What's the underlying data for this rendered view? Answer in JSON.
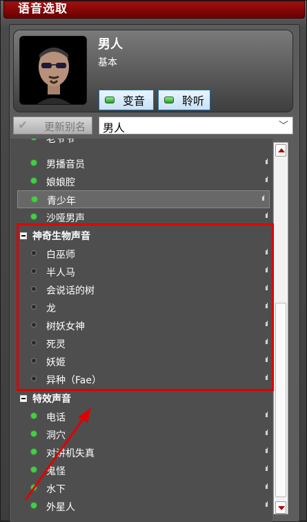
{
  "window": {
    "title": "语音选取"
  },
  "profile": {
    "name": "男人",
    "type": "基本"
  },
  "buttons": {
    "change_voice": "变音",
    "listen": "聆听"
  },
  "alias": {
    "button_label": "更新别名",
    "selected": "男人"
  },
  "list": {
    "partial_top": "老爷爷",
    "items_a": [
      "男播音员",
      "娘娘腔",
      "青少年",
      "沙哑男声"
    ],
    "category_1": "神奇生物声音",
    "items_b": [
      "白巫师",
      "半人马",
      "会说话的树",
      "龙",
      "树妖女神",
      "死灵",
      "妖姬",
      "异种（Fae）"
    ],
    "category_2": "特效声音",
    "items_c": [
      "电话",
      "洞穴",
      "对讲机失真",
      "鬼怪",
      "水下",
      "外星人"
    ],
    "signal_glyph": "ııl"
  },
  "colors": {
    "accent": "#a01010",
    "highlight": "#e00000",
    "status_on": "#3fd23f"
  }
}
